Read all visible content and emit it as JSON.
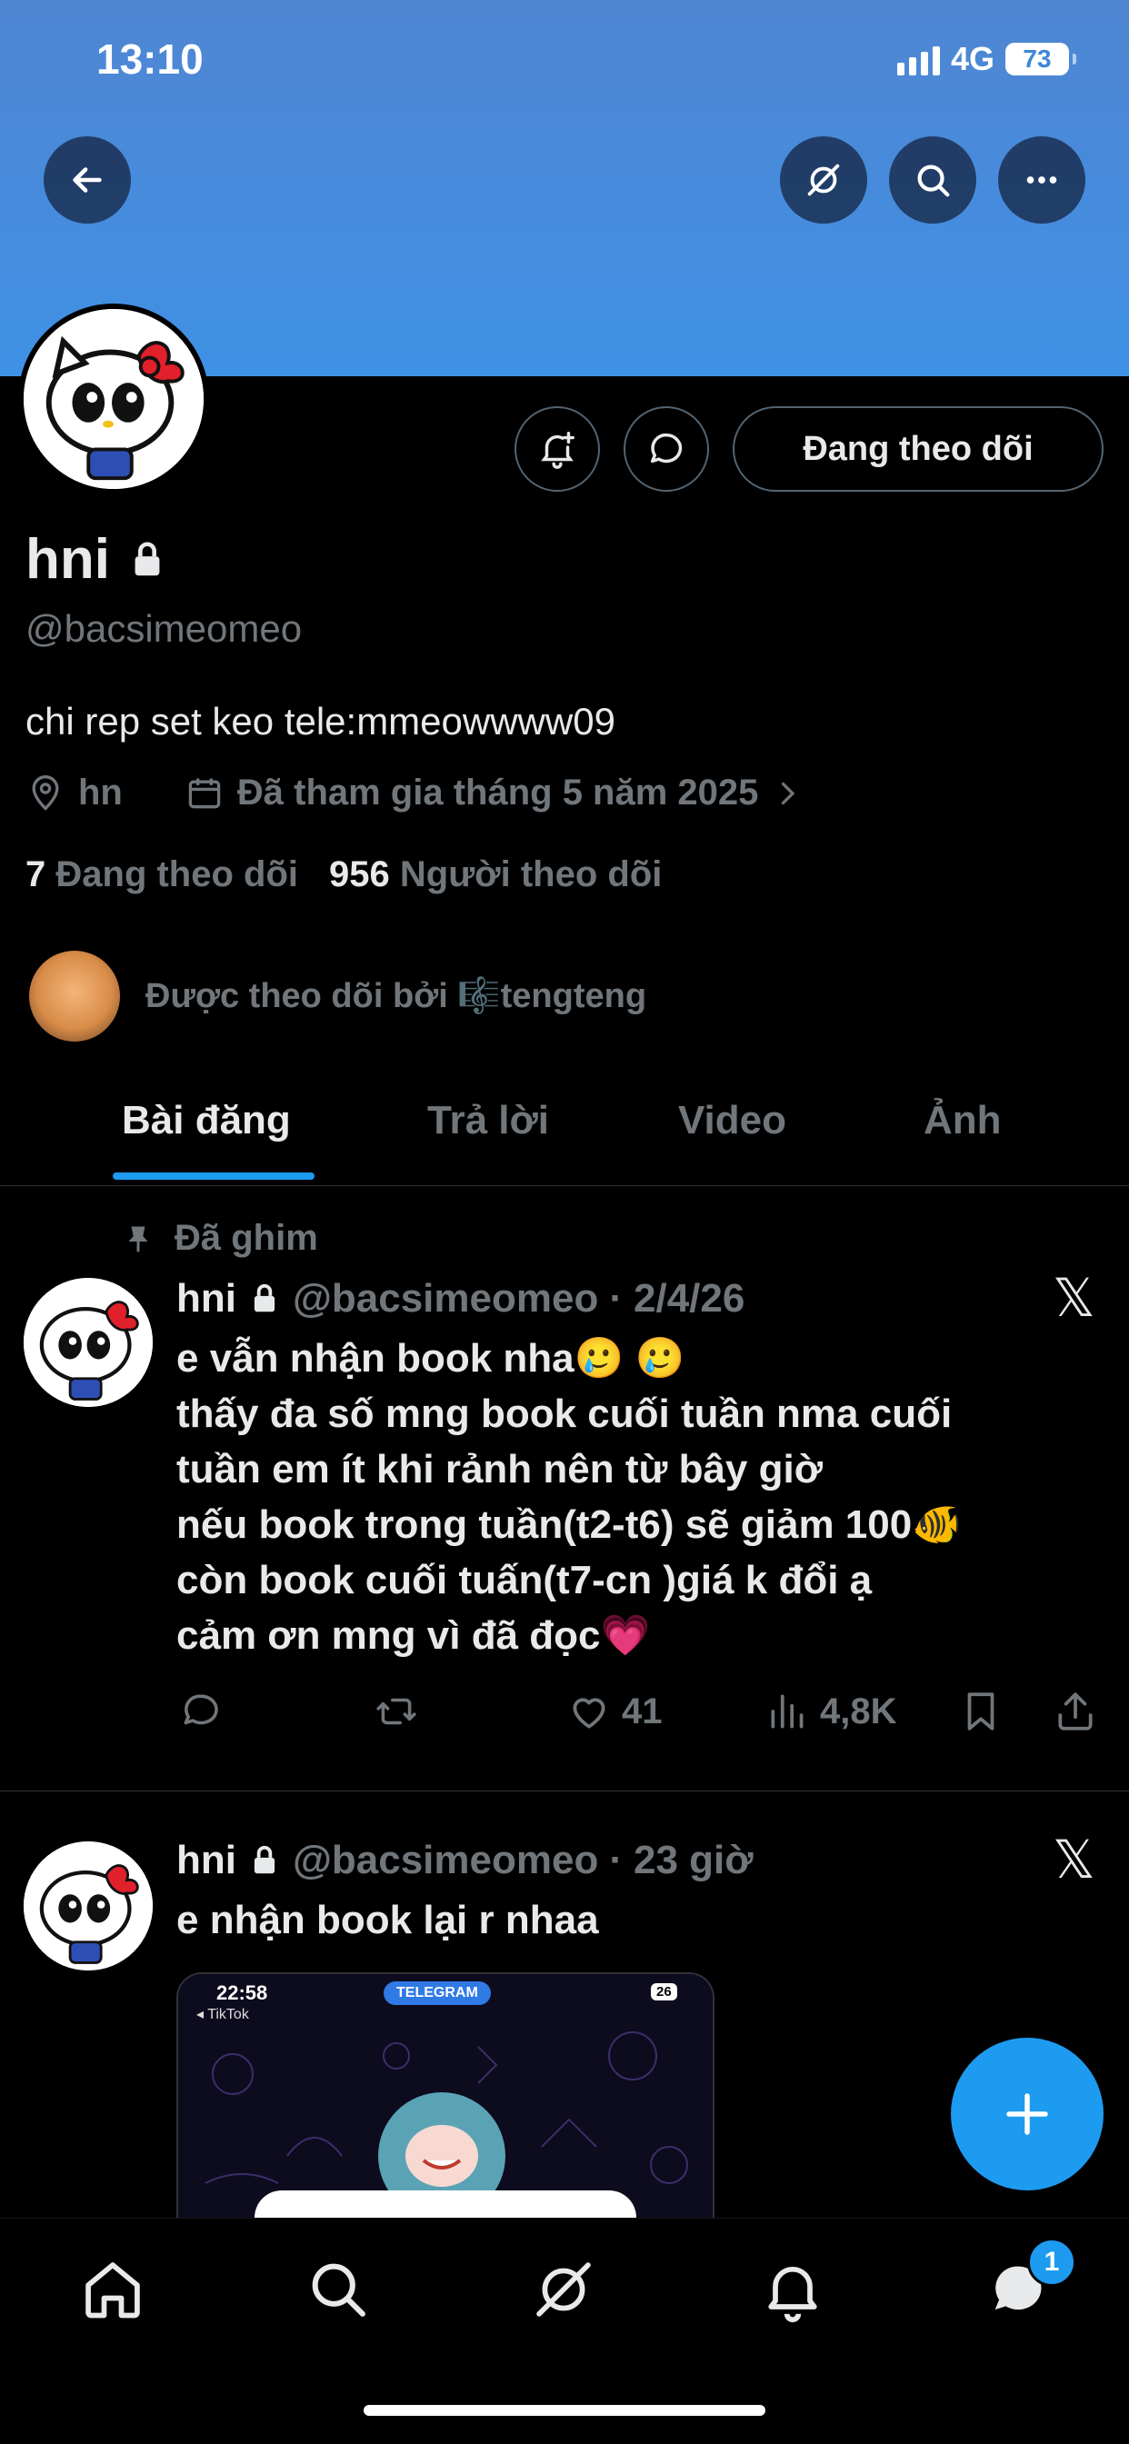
{
  "status": {
    "time": "13:10",
    "network": "4G",
    "battery": "73"
  },
  "profile": {
    "name": "hni",
    "handle": "@bacsimeomeo",
    "bio": "chi rep set keo tele:mmeowwww09",
    "location": "hn",
    "joined": "Đã tham gia tháng 5 năm 2025",
    "following_count": "7",
    "following_label": "Đang theo dõi",
    "followers_count": "956",
    "followers_label": "Người theo dõi",
    "followed_by": "Được theo dõi bởi 🎼tengteng",
    "follow_button": "Đang theo dõi"
  },
  "tabs": [
    {
      "label": "Bài đăng",
      "active": true
    },
    {
      "label": "Trả lời",
      "active": false
    },
    {
      "label": "Video",
      "active": false
    },
    {
      "label": "Ảnh",
      "active": false
    }
  ],
  "posts": [
    {
      "pinned_label": "Đã ghim",
      "name": "hni",
      "handle": "@bacsimeomeo",
      "time": "2/4/26",
      "lines": [
        "e vẫn nhận book nha🥲 🥲",
        "thấy đa số mng book cuối tuần nma cuối",
        "tuần em ít khi rảnh nên từ bây giờ",
        "nếu book trong tuần(t2-t6) sẽ giảm 100🐠",
        "còn book cuối tuấn(t7-cn )giá k đổi ạ",
        "cảm ơn mng vì đã đọc💗"
      ],
      "likes": "41",
      "views": "4,8K"
    },
    {
      "name": "hni",
      "handle": "@bacsimeomeo",
      "time": "23 giờ",
      "lines": [
        "e nhận book lại r nhaa"
      ],
      "media": {
        "time": "22:58",
        "back_app": "◂ TikTok",
        "app_label": "TELEGRAM",
        "battery": "26"
      }
    }
  ],
  "nav": {
    "message_badge": "1"
  },
  "colors": {
    "accent": "#1d9bf0",
    "banner": "#3f91e6",
    "muted": "#71767b"
  }
}
